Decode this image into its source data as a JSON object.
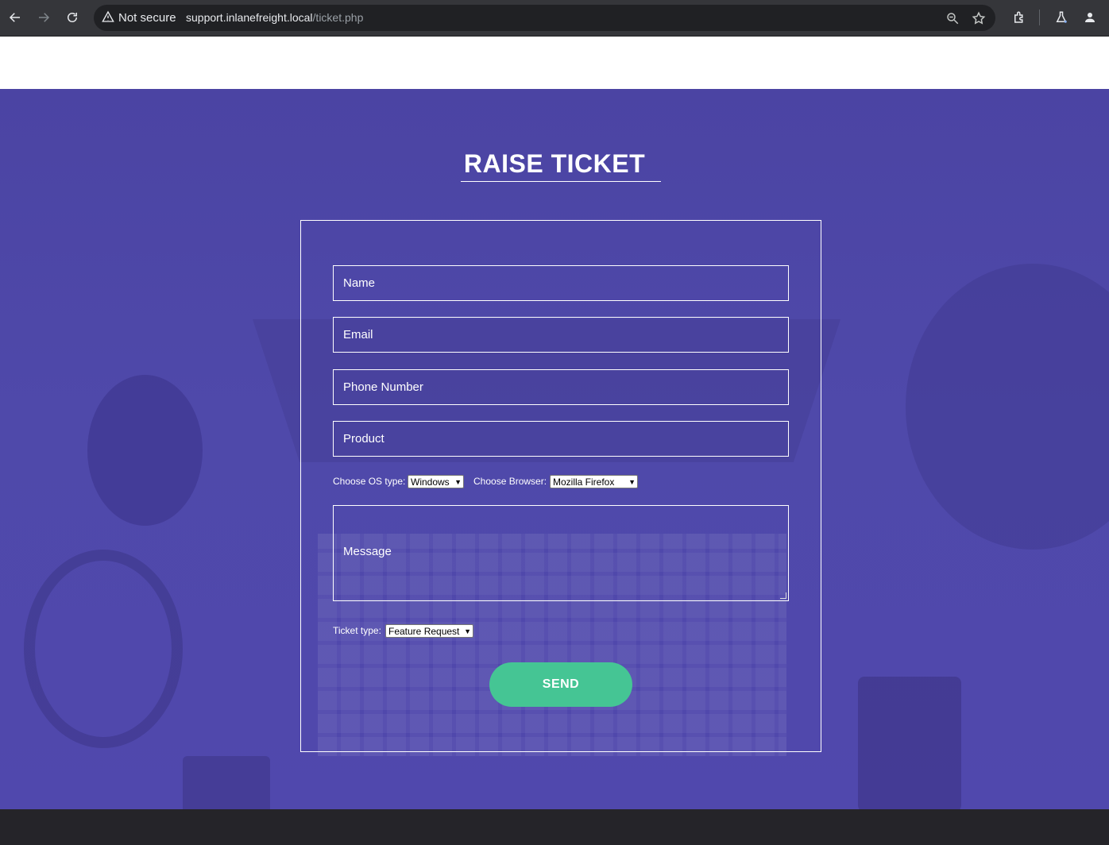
{
  "browser": {
    "security_label": "Not secure",
    "url_host": "support.inlanefreight.local",
    "url_path": "/ticket.php"
  },
  "page": {
    "title": "RAISE TICKET",
    "form": {
      "name_placeholder": "Name",
      "email_placeholder": "Email",
      "phone_placeholder": "Phone Number",
      "product_placeholder": "Product",
      "os_label": "Choose OS type:",
      "os_value": "Windows",
      "browser_label": "Choose Browser:",
      "browser_value": "Mozilla Firefox",
      "message_placeholder": "Message",
      "ticket_type_label": "Ticket type:",
      "ticket_type_value": "Feature Request",
      "send_label": "SEND"
    }
  },
  "colors": {
    "hero_bg": "#4f49aa",
    "send_button": "#45c594"
  }
}
